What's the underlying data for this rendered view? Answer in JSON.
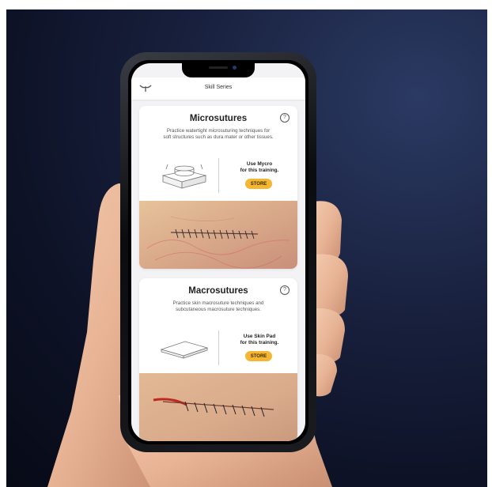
{
  "app": {
    "header_title": "Skill Series"
  },
  "cards": [
    {
      "title": "Microsutures",
      "description": "Practice watertight microsuturing techniques for soft structures such as dura mater or other tissues.",
      "use_line1": "Use Mycro",
      "use_line2": "for this training.",
      "store_label": "STORE",
      "help_symbol": "?"
    },
    {
      "title": "Macrosutures",
      "description": "Practice skin macrosuture techniques and subcutaneous macrosuture techniques.",
      "use_line1": "Use Skin Pad",
      "use_line2": "for this training.",
      "store_label": "STORE",
      "help_symbol": "?"
    }
  ],
  "colors": {
    "accent": "#f5b731",
    "background": "#0d1226"
  },
  "icons": [
    "logo-icon",
    "help-icon"
  ]
}
